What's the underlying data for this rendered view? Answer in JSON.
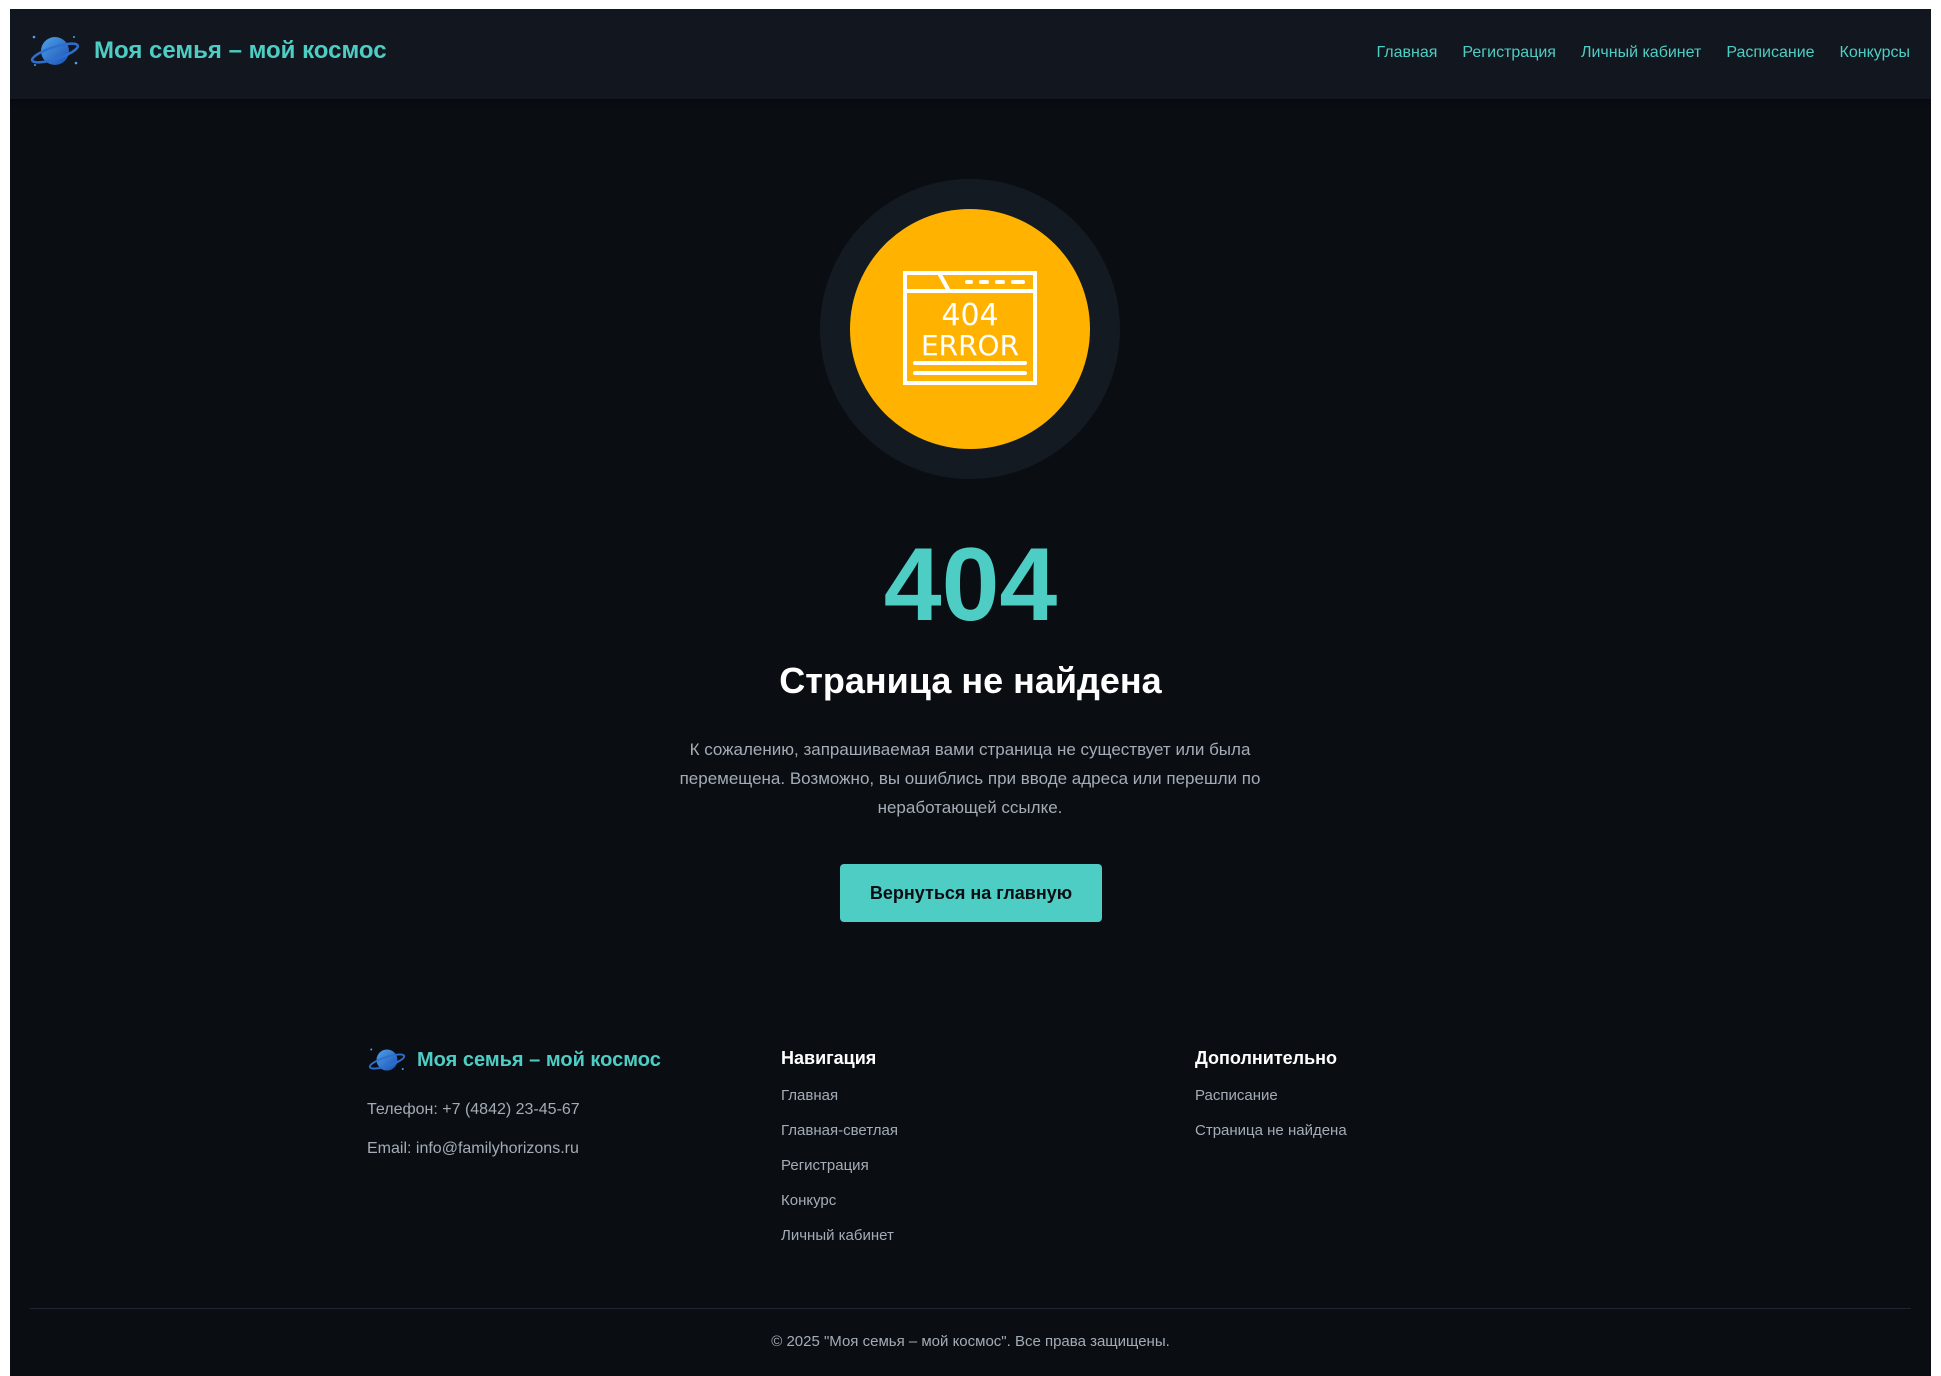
{
  "header": {
    "brand": "Моя семья – мой космос",
    "logo_icon": "planet-icon",
    "nav": [
      "Главная",
      "Регистрация",
      "Личный кабинет",
      "Расписание",
      "Конкурсы"
    ]
  },
  "main": {
    "illustration_icon": "404-error-icon",
    "illustration_text_top": "404",
    "illustration_text_bottom": "ERROR",
    "code": "404",
    "title": "Страница не найдена",
    "description": "К сожалению, запрашиваемая вами страница не существует или была перемещена. Возможно, вы ошиблись при вводе адреса или перешли по неработающей ссылке.",
    "home_button": "Вернуться на главную"
  },
  "footer": {
    "brand": "Моя семья – мой космос",
    "phone": "Телефон: +7 (4842) 23-45-67",
    "email": "Email: info@familyhorizons.ru",
    "nav_heading": "Навигация",
    "nav_links": [
      "Главная",
      "Главная-светлая",
      "Регистрация",
      "Конкурс",
      "Личный кабинет"
    ],
    "extra_heading": "Дополнительно",
    "extra_links": [
      "Расписание",
      "Страница не найдена"
    ],
    "copyright": "© 2025 \"Моя семья – мой космос\". Все права защищены."
  },
  "colors": {
    "accent": "#4ecdc4",
    "background": "#0a0e13",
    "header_bg": "#12171f",
    "icon_bg": "#ffb300",
    "muted_text": "#a4acb6"
  }
}
